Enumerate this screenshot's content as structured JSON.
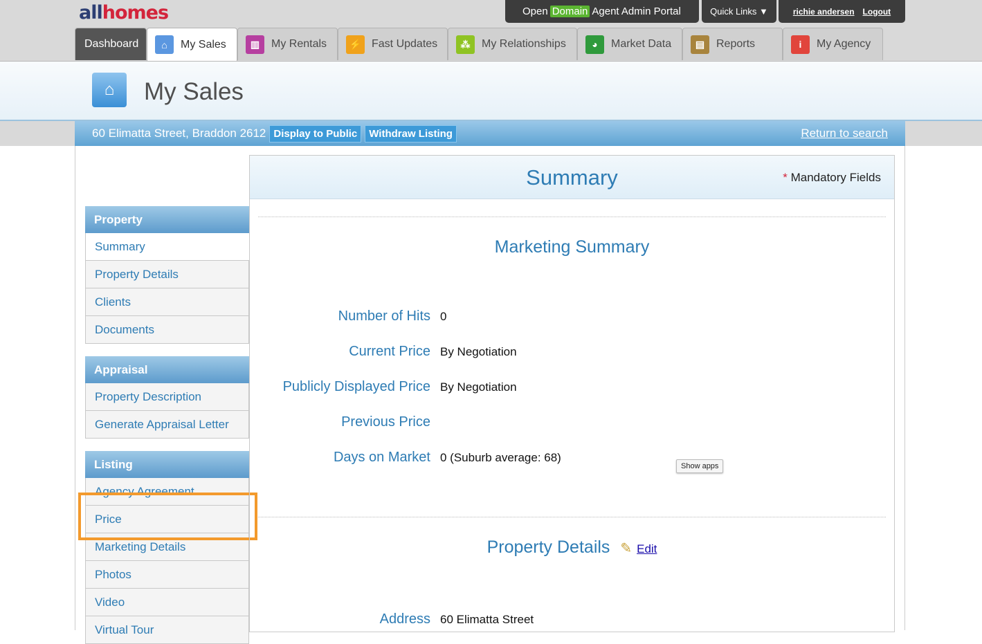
{
  "topbar": {
    "logo_all": "all",
    "logo_homes": "homes",
    "portal_open": "Open",
    "portal_domain": "Domain",
    "portal_rest": "Agent Admin Portal",
    "quick_links": "Quick Links ▼",
    "user_name": "richie andersen",
    "logout": "Logout"
  },
  "tabs": [
    {
      "label": "Dashboard"
    },
    {
      "label": "My Sales",
      "icon": "house-icon",
      "color": "#5b97e0"
    },
    {
      "label": "My Rentals",
      "icon": "building-icon",
      "color": "#b63fa0"
    },
    {
      "label": "Fast Updates",
      "icon": "lightning-icon",
      "color": "#f0a21b"
    },
    {
      "label": "My Relationships",
      "icon": "network-icon",
      "color": "#8fc323"
    },
    {
      "label": "Market Data",
      "icon": "pie-chart-icon",
      "color": "#2f9a3c"
    },
    {
      "label": "Reports",
      "icon": "document-icon",
      "color": "#a8843d"
    },
    {
      "label": "My Agency",
      "icon": "info-icon",
      "color": "#e1453c"
    }
  ],
  "header": {
    "title": "My Sales"
  },
  "address_bar": {
    "address": "60 Elimatta Street, Braddon 2612",
    "display_button": "Display to Public",
    "withdraw_button": "Withdraw Listing",
    "return_link": "Return to search"
  },
  "sidebar": {
    "sections": [
      {
        "title": "Property",
        "items": [
          "Summary",
          "Property Details",
          "Clients",
          "Documents"
        ]
      },
      {
        "title": "Appraisal",
        "items": [
          "Property Description",
          "Generate Appraisal Letter"
        ]
      },
      {
        "title": "Listing",
        "items": [
          "Agency Agreement",
          "Price",
          "Marketing Details",
          "Photos",
          "Video",
          "Virtual Tour"
        ]
      }
    ],
    "selected": "Summary"
  },
  "main": {
    "title": "Summary",
    "mandatory_star": "*",
    "mandatory_text": "Mandatory Fields",
    "marketing_title": "Marketing Summary",
    "fields": [
      {
        "label": "Number of Hits",
        "value": "0"
      },
      {
        "label": "Current Price",
        "value": "By Negotiation"
      },
      {
        "label": "Publicly Displayed Price",
        "value": "By Negotiation"
      },
      {
        "label": "Previous Price",
        "value": ""
      },
      {
        "label": "Days on Market",
        "value": "0 (Suburb average: 68)"
      }
    ],
    "show_apps": "Show apps",
    "property_details_title": "Property Details",
    "edit_link": "Edit",
    "address_label": "Address",
    "address_value": "60 Elimatta Street"
  },
  "colors": {
    "accent": "#2e7cb4",
    "highlight": "#f39a2d",
    "bar": "#5ea3d3"
  }
}
